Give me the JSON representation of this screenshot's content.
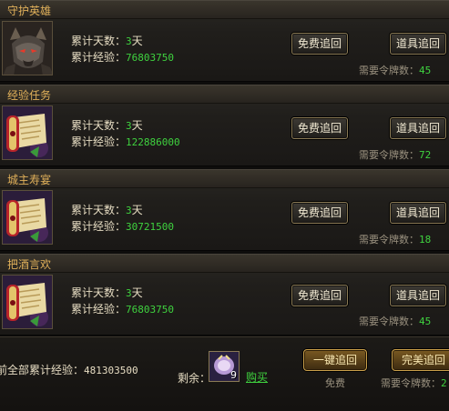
{
  "labels": {
    "days": "累计天数：",
    "exp": "累计经验：",
    "day_unit": "天",
    "tokens_needed": "需要令牌数："
  },
  "buttons": {
    "free_recall": "免费追回",
    "item_recall": "道具追回"
  },
  "tasks": [
    {
      "title": "守护英雄",
      "days": "3",
      "exp": "76803750",
      "tokens": "45",
      "icon": "guardian-hero-portrait-icon"
    },
    {
      "title": "经验任务",
      "days": "3",
      "exp": "122886000",
      "tokens": "72",
      "icon": "scroll-icon"
    },
    {
      "title": "城主寿宴",
      "days": "3",
      "exp": "30721500",
      "tokens": "18",
      "icon": "scroll-icon"
    },
    {
      "title": "把酒言欢",
      "days": "3",
      "exp": "76803750",
      "tokens": "45",
      "icon": "scroll-icon"
    }
  ],
  "footer": {
    "total_exp_label": "前全部累计经验：",
    "total_exp_value": "481303500",
    "remaining_label": "剩余：",
    "item_count": "9",
    "buy_link": "购买",
    "one_click_button": "一键追回",
    "one_click_caption": "免费",
    "perfect_button": "完美追回",
    "perfect_caption": "需要令牌数：",
    "perfect_tokens": "2"
  },
  "colors": {
    "accent_gold": "#e0b05a",
    "value_green": "#3fd23f"
  }
}
